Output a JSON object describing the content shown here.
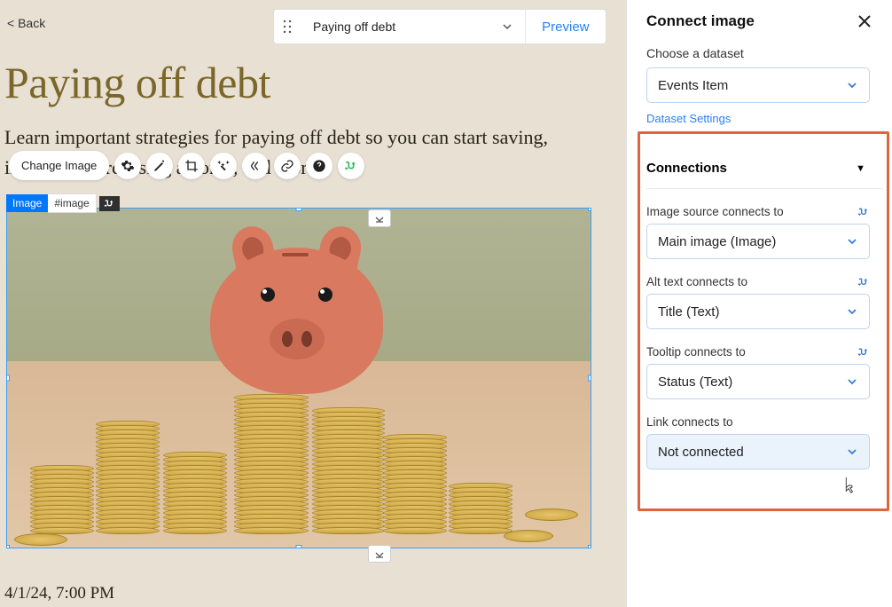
{
  "back_label": "< Back",
  "toolbar": {
    "title": "Paying off debt",
    "preview": "Preview"
  },
  "page": {
    "title": "Paying off debt",
    "description": "Learn important strategies for paying off debt so you can start saving, investing, purchasing a home, and more.",
    "timestamp": "4/1/24, 7:00 PM"
  },
  "image_toolbar": {
    "change": "Change Image"
  },
  "tags": {
    "type": "Image",
    "id": "#image"
  },
  "panel": {
    "title": "Connect image",
    "dataset_label": "Choose a dataset",
    "dataset_value": "Events Item",
    "settings_link": "Dataset Settings",
    "section_title": "Connections",
    "fields": [
      {
        "label": "Image source connects to",
        "value": "Main image (Image)"
      },
      {
        "label": "Alt text connects to",
        "value": "Title (Text)"
      },
      {
        "label": "Tooltip connects to",
        "value": "Status (Text)"
      },
      {
        "label": "Link connects to",
        "value": "Not connected"
      }
    ]
  }
}
